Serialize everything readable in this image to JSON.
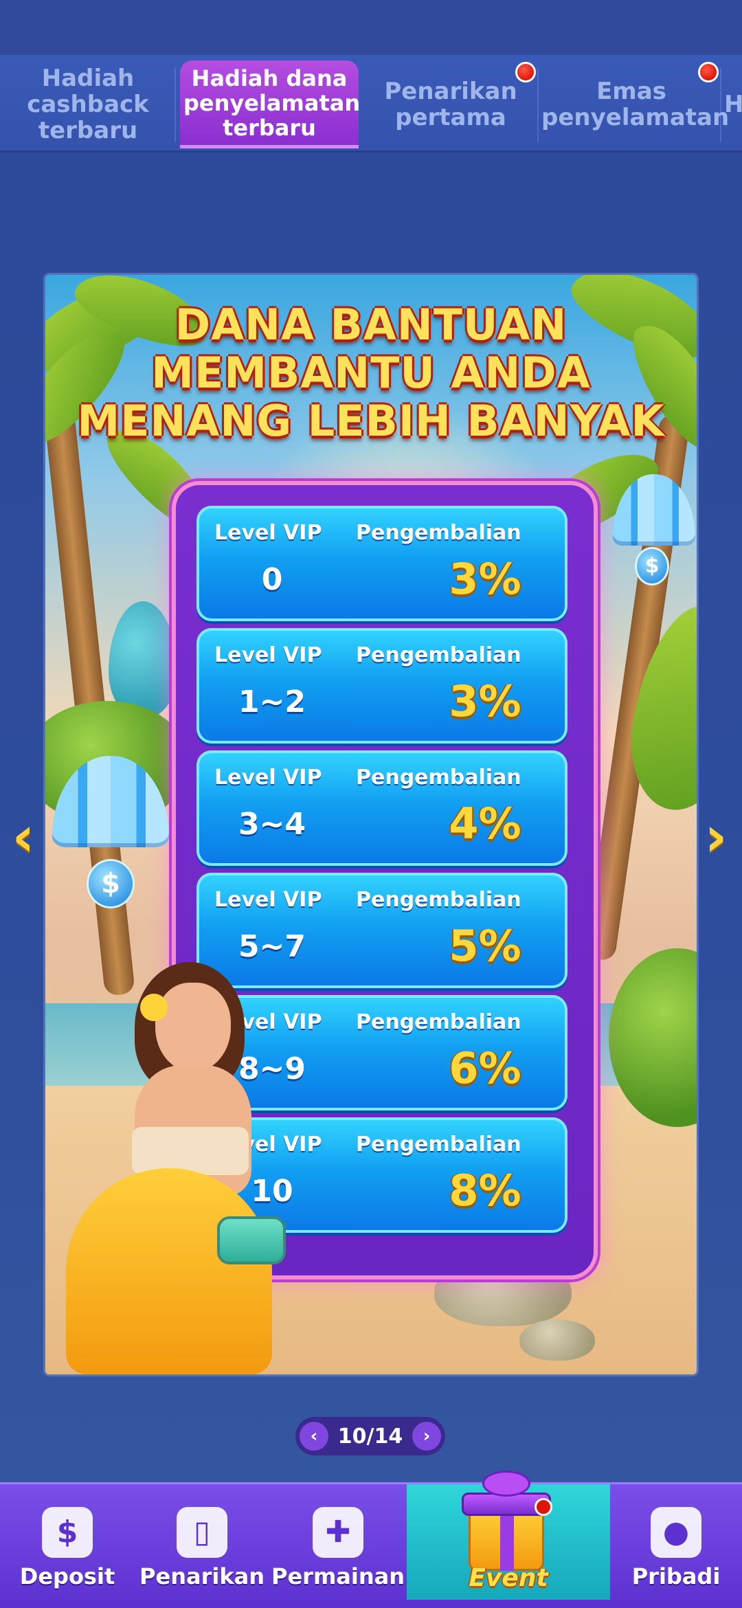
{
  "tabs": [
    {
      "label": "Hadiah cashback terbaru",
      "active": false,
      "badge": false
    },
    {
      "label": "Hadiah dana penyelamatan terbaru",
      "active": true,
      "badge": false
    },
    {
      "label": "Penarikan pertama",
      "active": false,
      "badge": true
    },
    {
      "label": "Emas penyelamatan",
      "active": false,
      "badge": true
    },
    {
      "label": "H",
      "active": false,
      "badge": false
    }
  ],
  "banner": {
    "headline_line1": "DANA BANTUAN",
    "headline_line2": "MEMBANTU ANDA",
    "headline_line3": "MENANG LEBIH BANYAK",
    "col_level_label": "Level VIP",
    "col_return_label": "Pengembalian",
    "rows": [
      {
        "level": "0",
        "percent": "3%"
      },
      {
        "level": "1~2",
        "percent": "3%"
      },
      {
        "level": "3~4",
        "percent": "4%"
      },
      {
        "level": "5~7",
        "percent": "5%"
      },
      {
        "level": "8~9",
        "percent": "6%"
      },
      {
        "level": "10",
        "percent": "8%"
      }
    ]
  },
  "pager": {
    "text": "10/14",
    "prev_icon": "‹",
    "next_icon": "›"
  },
  "nav": {
    "deposit": "Deposit",
    "withdraw": "Penarikan",
    "games": "Permainan",
    "event": "Event",
    "profile": "Pribadi"
  },
  "colors": {
    "background": "#2f4596",
    "active_tab": "#9b3fd8",
    "vip_row": "#12a0f2",
    "percent_gold": "#ffd93b",
    "nav_bg": "#6a40dc",
    "event_tab": "#1fb7c8"
  },
  "icons": {
    "left_arrow": "‹",
    "right_arrow": "›",
    "deposit": "$",
    "withdraw": "▯",
    "games": "✚",
    "profile": "●"
  }
}
